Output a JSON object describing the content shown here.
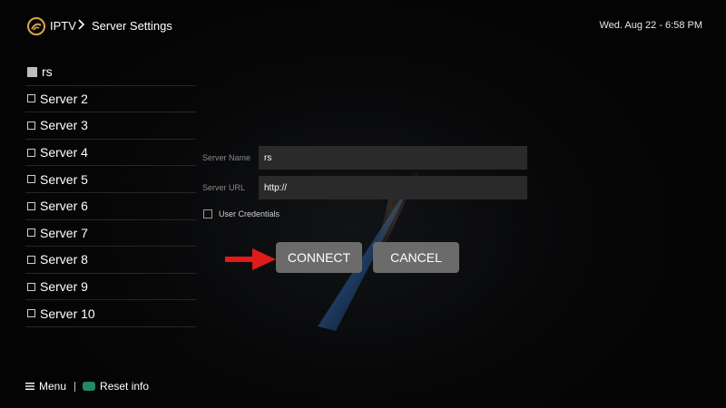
{
  "header": {
    "app": "IPTV",
    "page": "Server Settings",
    "datetime": "Wed. Aug 22 - 6:58 PM",
    "logo_icon": "iptv-logo-icon",
    "separator_icon": "chevron-right-icon"
  },
  "servers": [
    {
      "label": "rs",
      "selected": true
    },
    {
      "label": "Server 2",
      "selected": false
    },
    {
      "label": "Server 3",
      "selected": false
    },
    {
      "label": "Server 4",
      "selected": false
    },
    {
      "label": "Server 5",
      "selected": false
    },
    {
      "label": "Server 6",
      "selected": false
    },
    {
      "label": "Server 7",
      "selected": false
    },
    {
      "label": "Server 8",
      "selected": false
    },
    {
      "label": "Server 9",
      "selected": false
    },
    {
      "label": "Server 10",
      "selected": false
    }
  ],
  "form": {
    "server_name_label": "Server Name",
    "server_name_value": "rs",
    "server_url_label": "Server URL",
    "server_url_value": "http://",
    "credentials_label": "User Credentials",
    "credentials_checked": false
  },
  "buttons": {
    "connect": "CONNECT",
    "cancel": "CANCEL"
  },
  "footer": {
    "menu": "Menu",
    "reset": "Reset info",
    "menu_icon": "hamburger-menu-icon",
    "reset_icon": "green-key-icon"
  },
  "colors": {
    "background": "#050505",
    "button": "#6b6b6b",
    "input": "#2a2a2a",
    "arrow": "#e01b1b",
    "reset_key": "#1f8a63"
  }
}
